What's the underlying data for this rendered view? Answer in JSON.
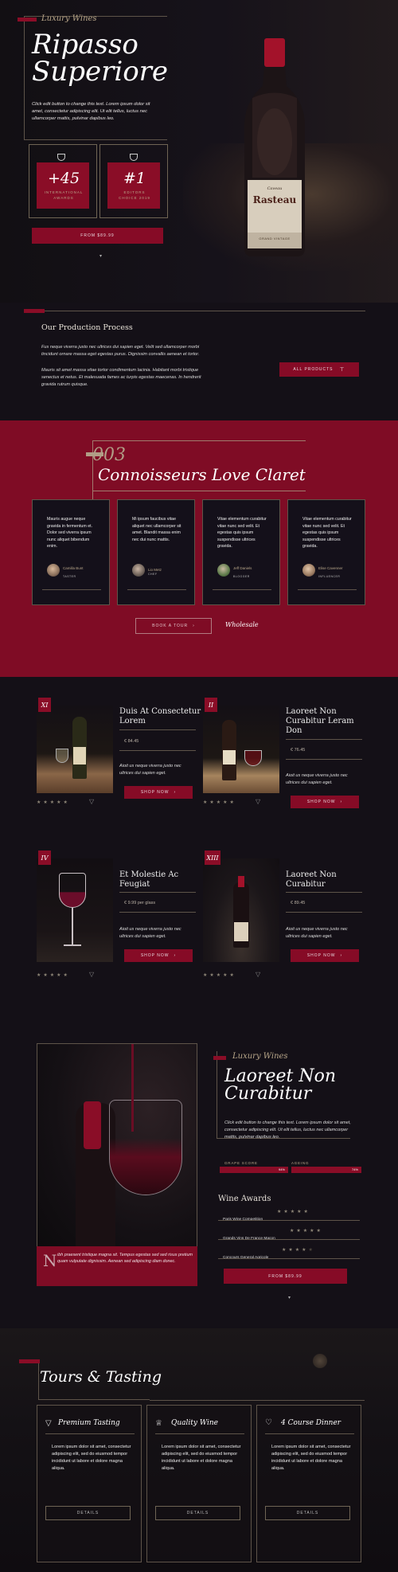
{
  "hero": {
    "brand": "Luxury Wines",
    "title_line1": "Ripasso",
    "title_line2": "Superiore",
    "intro": "Click edit button to change this text. Lorem ipsum dolor sit amet, consectetur adipiscing elit. Ut elit tellus, luctus nec ullamcorper mattis, pulvinar dapibus leo.",
    "award1_value": "+45",
    "award1_label_l1": "INTERNATIONAL",
    "award1_label_l2": "AWARDS",
    "award2_value": "#1",
    "award2_label_l1": "EDITORS",
    "award2_label_l2": "CHOICE 2019",
    "cta": "FROM $89.99",
    "label_brand": "Rasteau",
    "label_top": "Caveau",
    "label_bottom": "GRAND VINTAGE"
  },
  "production": {
    "title": "Our Production Process",
    "p1": "Fus neque viverra justo nec ultrices dui sapien eget. Velit sed ullamcorper morbi tincidunt ornare massa eget egestas purus. Dignissim convallis aenean et tortor.",
    "p2": "Mauris sit amet massa vitae tortor condimentum lacinia. Habitant morbi tristique senectus et netus. Et malesuada fames ac turpis egestas maecenas. In hendrerit gravida rutrum quisque.",
    "button": "ALL PRODUCTS"
  },
  "testimonials": {
    "number": "003",
    "title": "Connoisseurs Love Claret",
    "cards": [
      {
        "text": "Mauris augue neque gravida in fermentum et. Dolor sed viverra ipsum nunc aliquet bibendum enim.",
        "name": "Camilla Bunt",
        "role": "TASTER"
      },
      {
        "text": "Mi ipsum faucibus vitae aliquet nec ullamcorper sit amet. Blandit massa enim nec dui nunc mattis.",
        "name": "Lio Metz",
        "role": "CHEF"
      },
      {
        "text": "Vitae elementum curabitur vitae nunc sed velit. Et egestas quis ipsum suspendisse ultrices gravida.",
        "name": "Jeff Daniels",
        "role": "BLOGGER"
      },
      {
        "text": "Vitae elementum curabitur vitae nunc sed velit. Et egestas quis ipsum suspendisse ultrices gravida.",
        "name": "Elise Cavenner",
        "role": "INFLUENCER"
      }
    ],
    "tour_button": "BOOK A TOUR",
    "wholesale": "Wholesale"
  },
  "products": [
    {
      "numeral": "XI",
      "name_l1": "Duis At Consectetur",
      "name_l2": "Lorem",
      "name_l3": "",
      "price": "€ 84.45",
      "desc": "Aioit us neque viverra justo nec ultrices dui sapien eget.",
      "button": "SHOP NOW"
    },
    {
      "numeral": "II",
      "name_l1": "Laoreet Non",
      "name_l2": "Curabitur Leram",
      "name_l3": "Don",
      "price": "€ 76.45",
      "desc": "Aioit us neque viverra justo nec ultrices dui sapien eget.",
      "button": "SHOP NOW"
    },
    {
      "numeral": "IV",
      "name_l1": "Et Molestie Ac",
      "name_l2": "Feugiat",
      "name_l3": "",
      "price": "€ 9.99 per glass",
      "desc": "Aioit us neque viverra justo nec ultrices dui sapien eget.",
      "button": "SHOP NOW"
    },
    {
      "numeral": "XIII",
      "name_l1": "Laoreet Non",
      "name_l2": "Curabitur",
      "name_l3": "",
      "price": "€ 89.45",
      "desc": "Aioit us neque viverra justo nec ultrices dui sapien eget.",
      "button": "SHOP NOW"
    }
  ],
  "feature": {
    "brand": "Luxury Wines",
    "title_l1": "Laoreet Non",
    "title_l2": "Curabitur",
    "intro": "Click edit button to change this text. Lorem ipsum dolor sit amet, consectetur adipiscing elit. Ut elit tellus, luctus nec ullamcorper mattis, pulvinar dapibus leo.",
    "grape_label": "GRAPE SCORE",
    "grape_value": "94%",
    "aging_label": "AGEING",
    "aging_value": "74%",
    "awards_title": "Wine Awards",
    "awards": [
      {
        "name": "Paris Wine Competition",
        "stars": 5
      },
      {
        "name": "Grands Vins De France Macon",
        "stars": 5
      },
      {
        "name": "Concours General Agricole",
        "stars": 4
      }
    ],
    "quote_initial": "N",
    "quote": "ibh praesent tristique magna sit. Tempus egestas sed sed risus pretium quam vulputate dignissim. Aenean sed adipiscing diam donec.",
    "cta": "FROM $89.99"
  },
  "tours": {
    "title": "Tours & Tasting",
    "cards": [
      {
        "title": "Premium Tasting",
        "icon": "wine-glass-icon",
        "text": "Lorem ipsum dolor sit amet, consectetur adipiscing elit, sed do eiusmod tempor incididunt ut labore et dolore magna aliqua.",
        "button": "DETAILS"
      },
      {
        "title": "Quality Wine",
        "icon": "trophy-icon",
        "text": "Lorem ipsum dolor sit amet, consectetur adipiscing elit, sed do eiusmod tempor incididunt ut labore et dolore magna aliqua.",
        "button": "DETAILS"
      },
      {
        "title": "4 Course Dinner",
        "icon": "heart-icon",
        "text": "Lorem ipsum dolor sit amet, consectetur adipiscing elit, sed do eiusmod tempor incididunt ut labore et dolore magna aliqua.",
        "button": "DETAILS"
      }
    ]
  },
  "colors": {
    "accent": "#8a0d27",
    "gold": "#b9a78a",
    "background": "#131018"
  }
}
